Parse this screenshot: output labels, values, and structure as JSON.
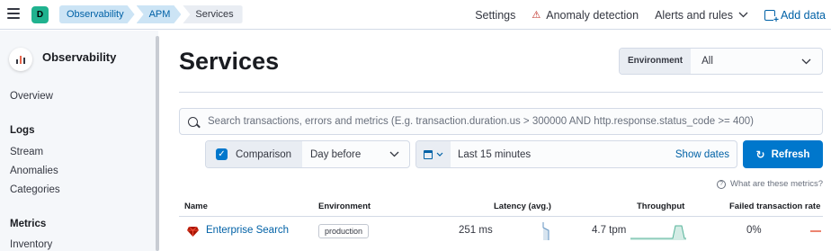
{
  "header": {
    "space_initial": "D",
    "breadcrumbs": [
      "Observability",
      "APM",
      "Services"
    ],
    "links": {
      "settings": "Settings",
      "anomaly_detection": "Anomaly detection",
      "alerts_and_rules": "Alerts and rules",
      "add_data": "Add data"
    }
  },
  "sidebar": {
    "title": "Observability",
    "overview": "Overview",
    "sections": [
      {
        "heading": "Logs",
        "items": [
          "Stream",
          "Anomalies",
          "Categories"
        ]
      },
      {
        "heading": "Metrics",
        "items": [
          "Inventory"
        ]
      }
    ]
  },
  "page": {
    "title": "Services",
    "environment_label": "Environment",
    "environment_value": "All",
    "search_placeholder": "Search transactions, errors and metrics (E.g. transaction.duration.us > 300000 AND http.response.status_code >= 400)",
    "comparison_label": "Comparison",
    "comparison_checked": true,
    "comparison_value": "Day before",
    "date_range": "Last 15 minutes",
    "show_dates": "Show dates",
    "refresh": "Refresh",
    "metrics_help": "What are these metrics?"
  },
  "table": {
    "columns": [
      "Name",
      "Environment",
      "Latency (avg.)",
      "Throughput",
      "Failed transaction rate"
    ],
    "rows": [
      {
        "name": "Enterprise Search",
        "environment": "production",
        "latency": "251 ms",
        "throughput": "4.7 tpm",
        "failed_rate": "0%"
      }
    ]
  },
  "colors": {
    "accent": "#0077cc",
    "link": "#0061a6",
    "latency_spark": "#6092c0",
    "throughput_spark": "#54b399",
    "failed_spark": "#e7664c"
  }
}
